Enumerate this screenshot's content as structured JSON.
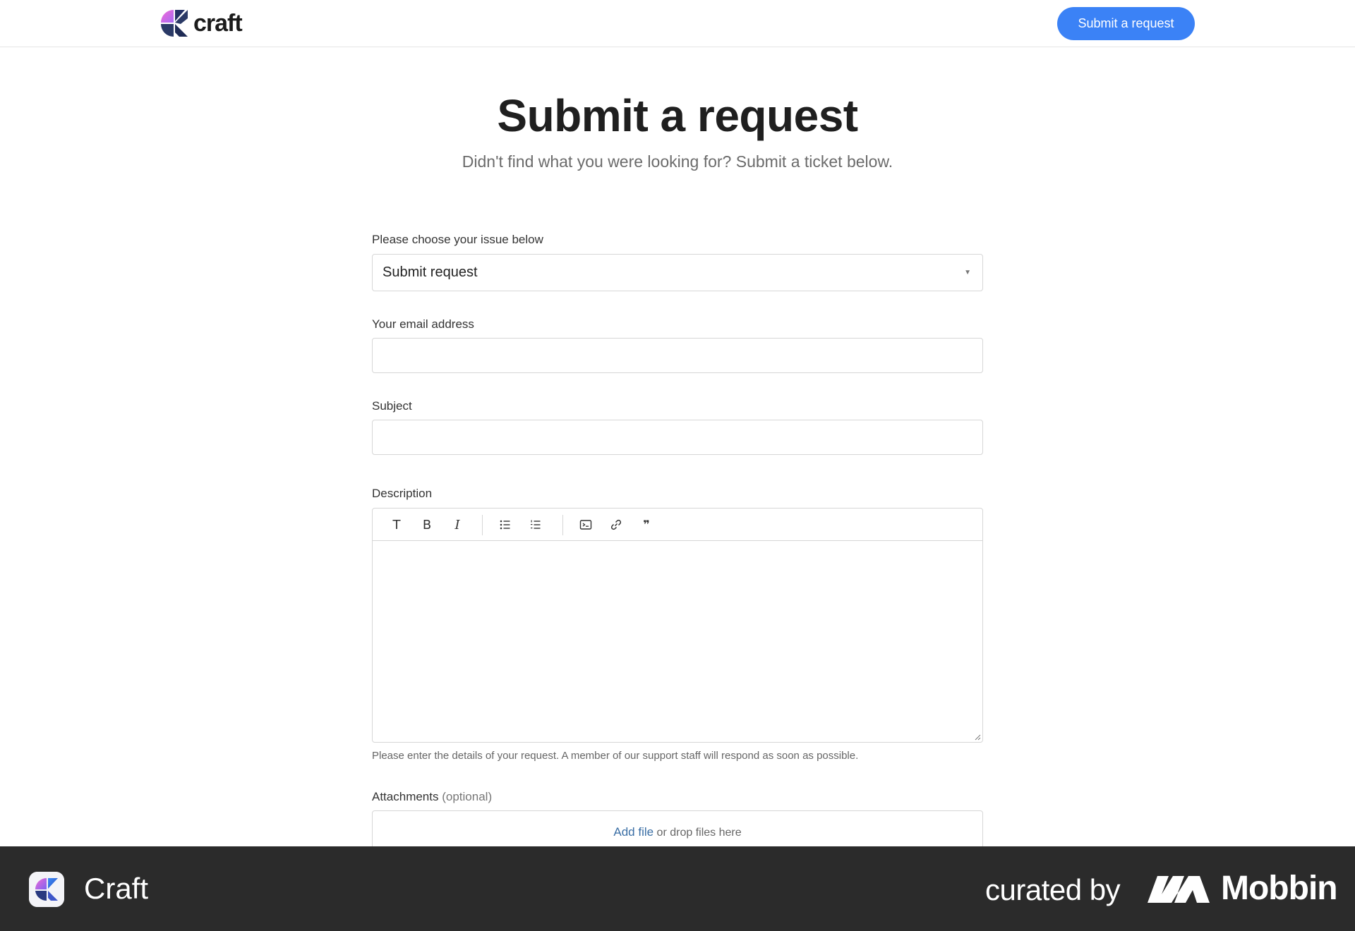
{
  "header": {
    "brand_name": "craft",
    "cta_label": "Submit a request"
  },
  "page": {
    "title": "Submit a request",
    "subtitle": "Didn't find what you were looking for? Submit a ticket below."
  },
  "form": {
    "issue_label": "Please choose your issue below",
    "issue_selected": "Submit request",
    "email_label": "Your email address",
    "email_value": "",
    "subject_label": "Subject",
    "subject_value": "",
    "description_label": "Description",
    "description_value": "",
    "description_hint": "Please enter the details of your request. A member of our support staff will respond as soon as possible.",
    "toolbar": {
      "text_glyph": "T",
      "bold_glyph": "B",
      "italic_glyph": "I",
      "bullet_list_icon": "bulleted-list-icon",
      "numbered_list_icon": "numbered-list-icon",
      "code_icon": "code-block-icon",
      "link_icon": "link-icon",
      "quote_glyph": "❞"
    },
    "attachments_label": "Attachments",
    "attachments_optional": "(optional)",
    "add_file_link": "Add file",
    "drop_text": "or drop files here"
  },
  "footer": {
    "app_name": "Craft",
    "curated_by": "curated by",
    "mobbin": "Mobbin"
  },
  "colors": {
    "accent": "#3b82f6",
    "link": "#3a6ea5",
    "footer_bg": "#2b2b2b"
  }
}
